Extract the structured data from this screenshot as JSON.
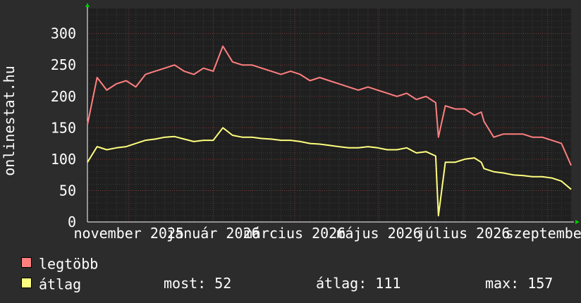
{
  "chart_data": {
    "type": "line",
    "ylabel": "onlinestat.hu",
    "ylim": [
      0,
      340
    ],
    "yticks": [
      0,
      50,
      100,
      150,
      200,
      250,
      300
    ],
    "x_tick_labels": [
      "november 2025",
      "január 2026",
      "március 2026",
      "május 2026",
      "július 2026",
      "szeptember"
    ],
    "x_range_days": 350,
    "x_tick_days": [
      30,
      91,
      150,
      211,
      272,
      333
    ],
    "grid": true,
    "series": [
      {
        "name": "legtöbb",
        "color": "#ff7f7f",
        "x_days": [
          0,
          7,
          14,
          21,
          28,
          35,
          42,
          49,
          56,
          63,
          70,
          77,
          84,
          91,
          98,
          105,
          112,
          119,
          126,
          133,
          140,
          147,
          154,
          161,
          168,
          175,
          182,
          189,
          196,
          203,
          210,
          217,
          224,
          231,
          238,
          245,
          252,
          254,
          259,
          266,
          273,
          280,
          285,
          287,
          294,
          301,
          308,
          315,
          322,
          329,
          336,
          343,
          350
        ],
        "values": [
          155,
          230,
          210,
          220,
          225,
          215,
          235,
          240,
          245,
          250,
          240,
          235,
          245,
          240,
          280,
          255,
          250,
          250,
          245,
          240,
          235,
          240,
          235,
          225,
          230,
          225,
          220,
          215,
          210,
          215,
          210,
          205,
          200,
          205,
          195,
          200,
          190,
          135,
          185,
          180,
          180,
          170,
          175,
          160,
          135,
          140,
          140,
          140,
          135,
          135,
          130,
          125,
          90
        ]
      },
      {
        "name": "átlag",
        "color": "#ffff7f",
        "x_days": [
          0,
          7,
          14,
          21,
          28,
          35,
          42,
          49,
          56,
          63,
          70,
          77,
          84,
          91,
          98,
          105,
          112,
          119,
          126,
          133,
          140,
          147,
          154,
          161,
          168,
          175,
          182,
          189,
          196,
          203,
          210,
          217,
          224,
          231,
          238,
          245,
          252,
          254,
          259,
          266,
          273,
          280,
          285,
          287,
          294,
          301,
          308,
          315,
          322,
          329,
          336,
          343,
          350
        ],
        "values": [
          95,
          120,
          115,
          118,
          120,
          125,
          130,
          132,
          135,
          136,
          132,
          128,
          130,
          130,
          150,
          138,
          135,
          135,
          133,
          132,
          130,
          130,
          128,
          125,
          124,
          122,
          120,
          118,
          118,
          120,
          118,
          115,
          115,
          118,
          110,
          112,
          105,
          10,
          95,
          95,
          100,
          102,
          95,
          85,
          80,
          78,
          75,
          74,
          72,
          72,
          70,
          65,
          52
        ]
      }
    ]
  },
  "legend": [
    {
      "label": "legtöbb",
      "color": "#ff7f7f"
    },
    {
      "label": "átlag",
      "color": "#ffff7f"
    }
  ],
  "stats": {
    "most": "most: 52",
    "atlag": "átlag: 111",
    "max": "max: 157"
  }
}
